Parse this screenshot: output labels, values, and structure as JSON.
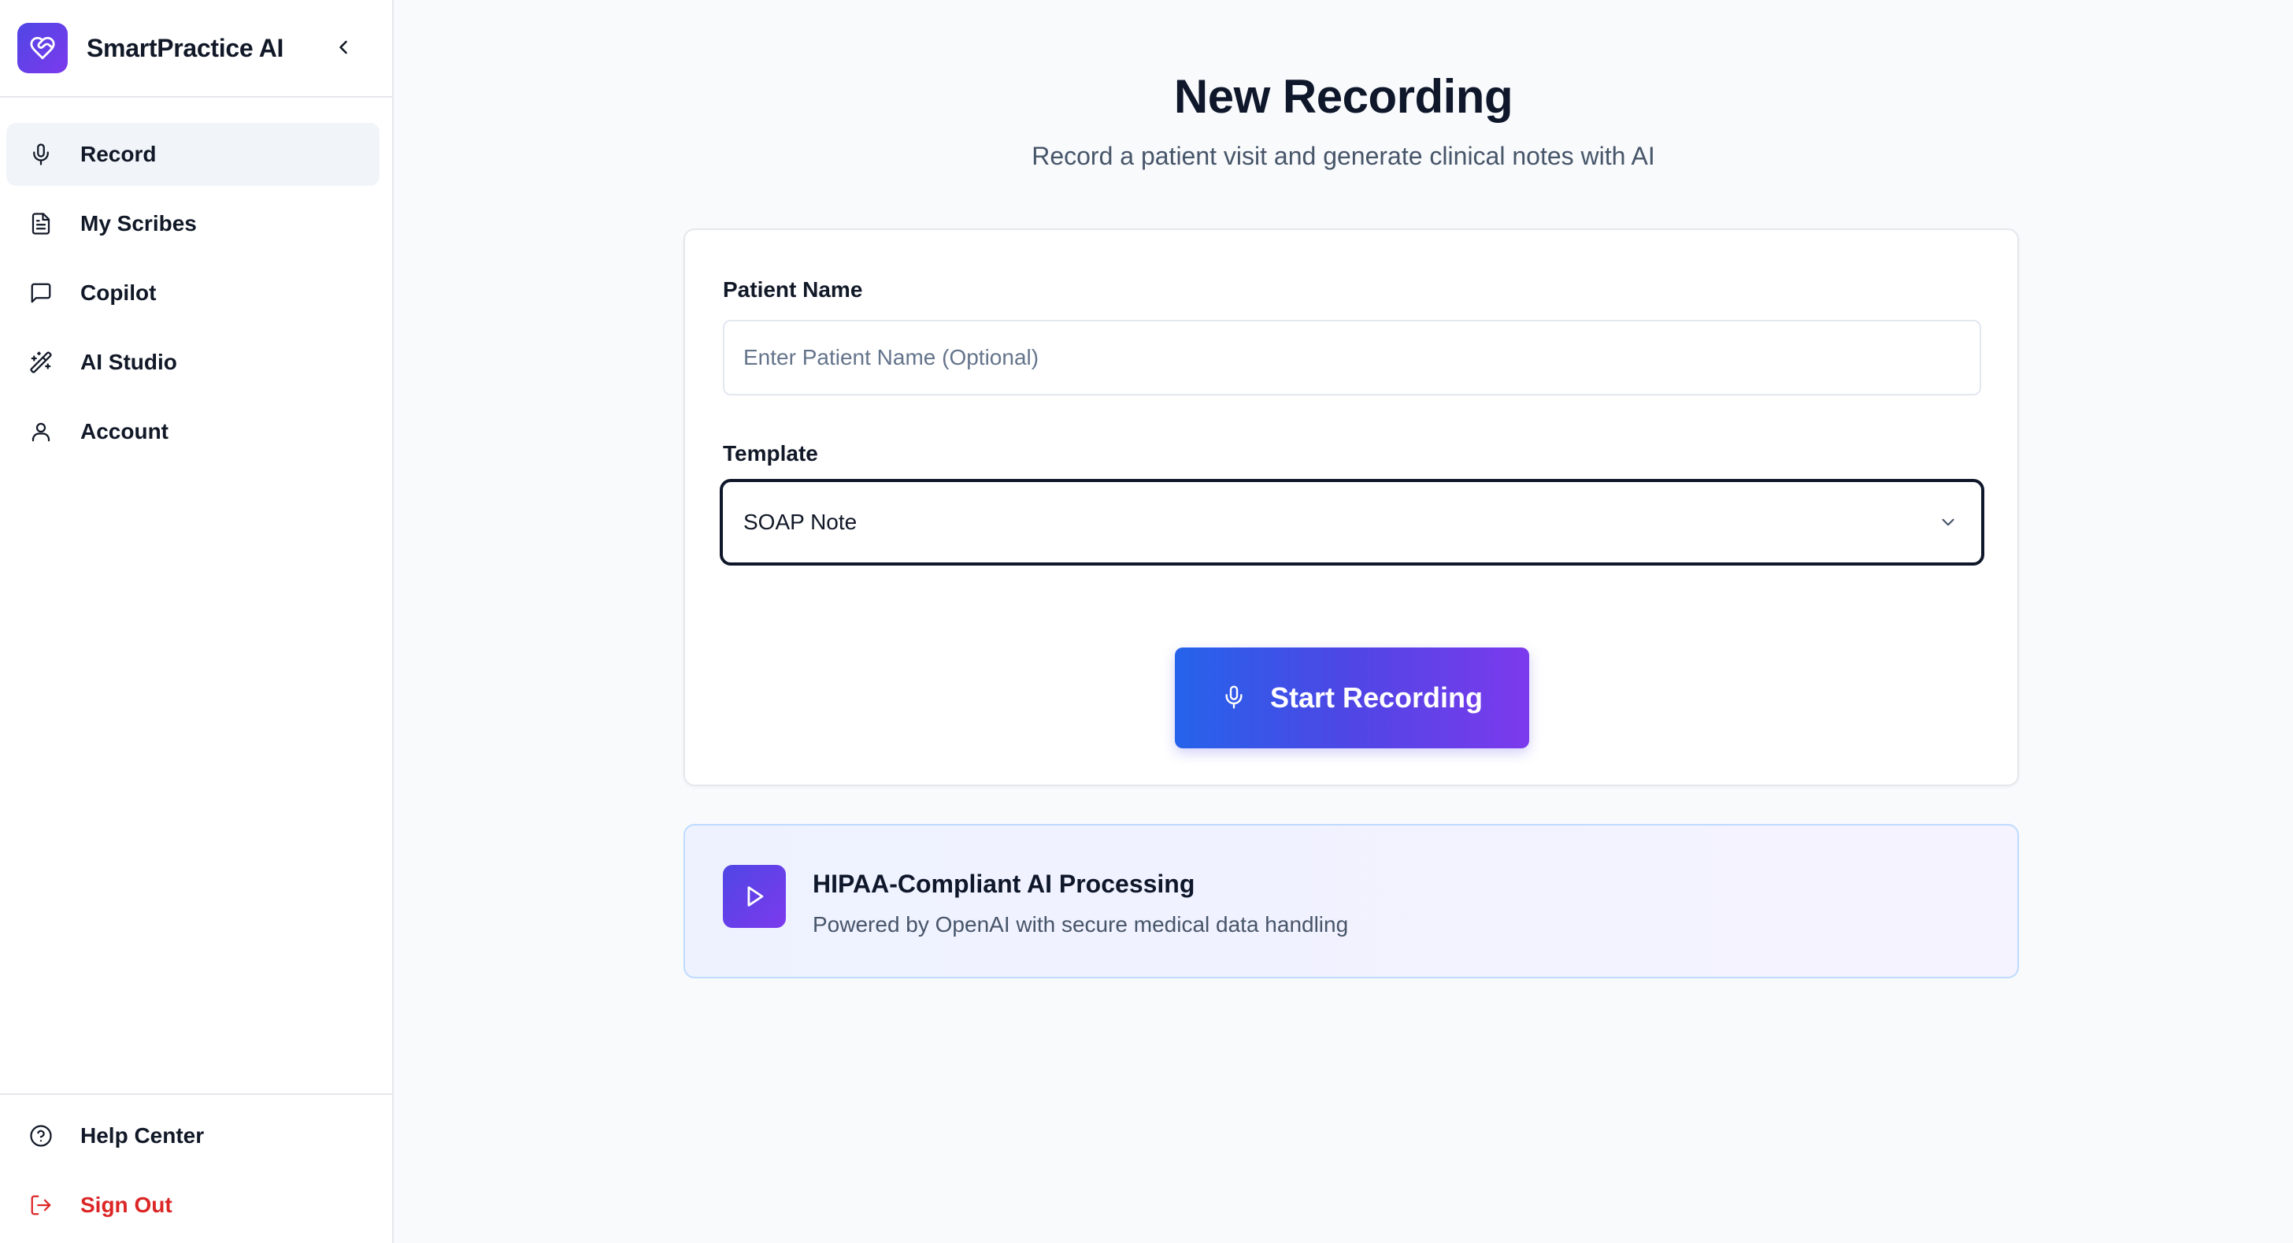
{
  "brand": {
    "name": "SmartPractice AI",
    "logo_icon": "heart-handshake-icon",
    "accent_from": "#4f46e5",
    "accent_to": "#7c3aed"
  },
  "sidebar": {
    "collapse_icon": "chevron-left-icon",
    "items": [
      {
        "label": "Record",
        "icon": "microphone-icon",
        "active": true
      },
      {
        "label": "My Scribes",
        "icon": "document-icon",
        "active": false
      },
      {
        "label": "Copilot",
        "icon": "chat-bubble-icon",
        "active": false
      },
      {
        "label": "AI Studio",
        "icon": "magic-wand-icon",
        "active": false
      },
      {
        "label": "Account",
        "icon": "user-icon",
        "active": false
      }
    ],
    "footer": [
      {
        "label": "Help Center",
        "icon": "help-circle-icon"
      },
      {
        "label": "Sign Out",
        "icon": "logout-icon",
        "color": "#dc2626"
      }
    ]
  },
  "main": {
    "title": "New Recording",
    "subtitle": "Record a patient visit and generate clinical notes with AI",
    "form": {
      "patient_label": "Patient Name",
      "patient_placeholder": "Enter Patient Name (Optional)",
      "patient_value": "",
      "template_label": "Template",
      "template_value": "SOAP Note"
    },
    "start_button": {
      "label": "Start Recording",
      "icon": "microphone-icon"
    },
    "info": {
      "icon": "play-icon",
      "title": "HIPAA-Compliant AI Processing",
      "description": "Powered by OpenAI with secure medical data handling"
    }
  }
}
